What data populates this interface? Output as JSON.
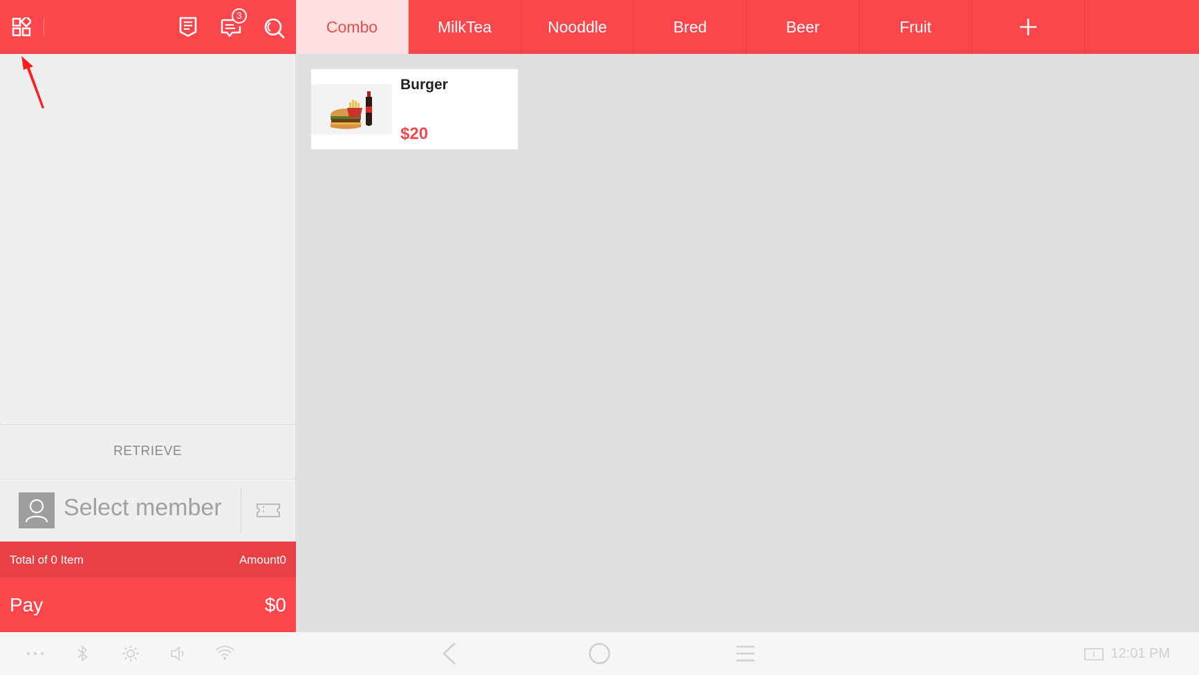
{
  "topbar": {
    "icons": {
      "menu": "grid-icon",
      "orders": "receipt-icon",
      "messages": "message-icon",
      "search": "search-icon"
    },
    "message_count": "3"
  },
  "tabs": [
    {
      "label": "Combo",
      "active": true
    },
    {
      "label": "MilkTea",
      "active": false
    },
    {
      "label": "Nooddle",
      "active": false
    },
    {
      "label": "Bred",
      "active": false
    },
    {
      "label": "Beer",
      "active": false
    },
    {
      "label": "Fruit",
      "active": false
    }
  ],
  "add_tab_icon": "plus-icon",
  "cart": {
    "retrieve_label": "RETRIEVE",
    "member_label": "Select member",
    "total_items": "Total of 0 Item",
    "amount": "Amount0",
    "pay_label": "Pay",
    "pay_amount": "$0"
  },
  "products": [
    {
      "name": "Burger",
      "price": "$20"
    }
  ],
  "statusbar": {
    "time": "12:01 PM"
  },
  "colors": {
    "accent": "#fb464c",
    "accent_dark": "#e84045",
    "active_tab_bg": "#ffe0e0",
    "content_bg": "#e0e0e0"
  }
}
